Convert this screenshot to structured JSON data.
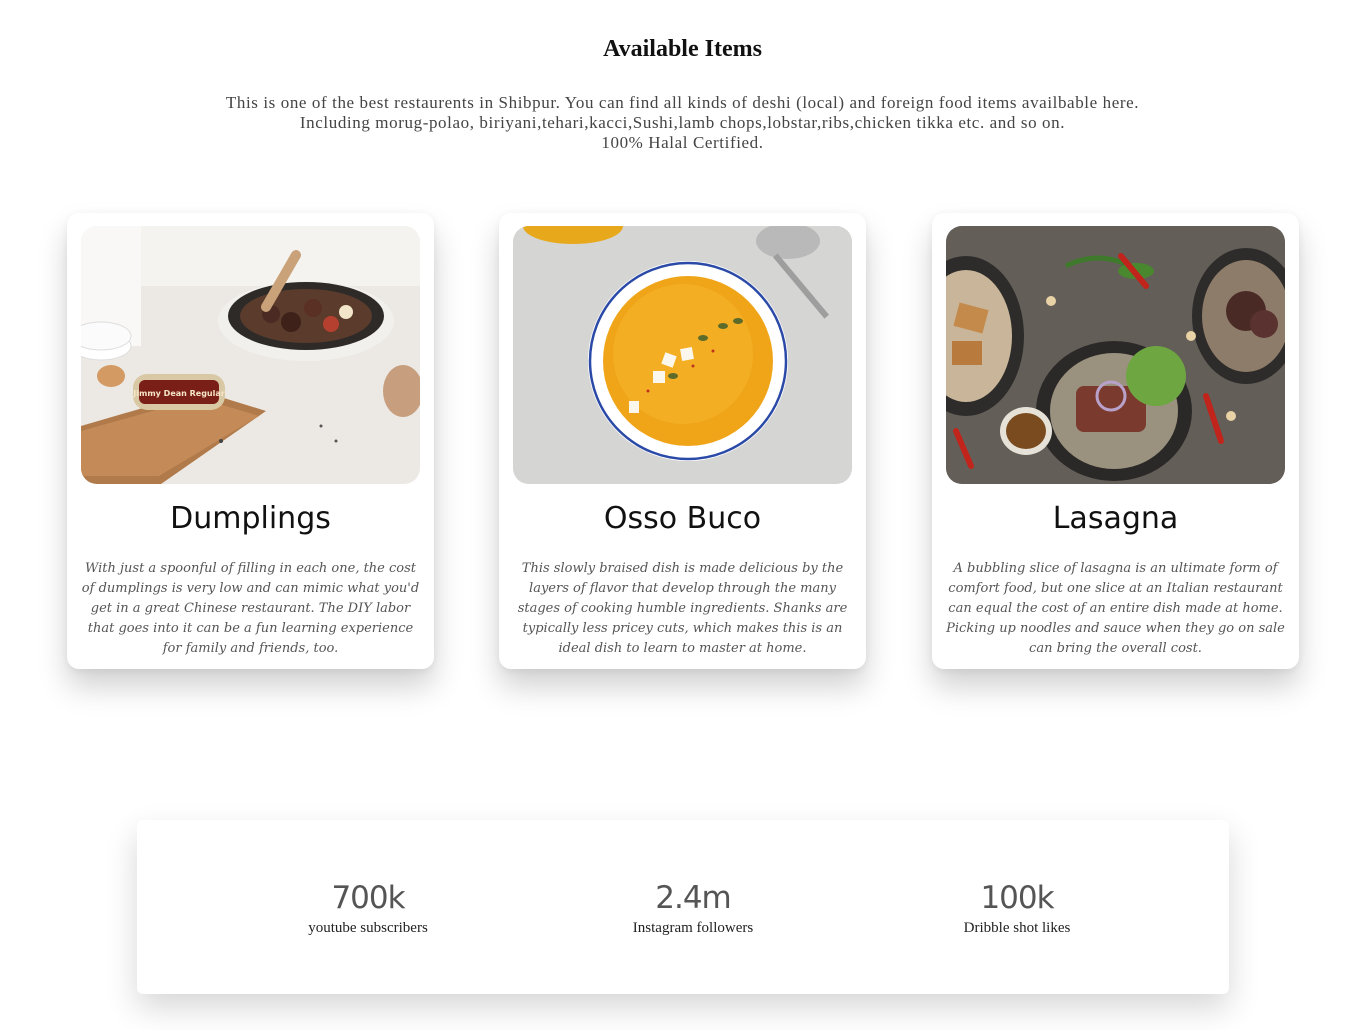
{
  "section": {
    "title": "Available Items",
    "intro_lines": [
      "This is one of the best restaurents in Shibpur. You can find all kinds of deshi (local) and foreign food items availbable here.",
      "Including morug-polao, biriyani,tehari,kacci,Sushi,lamb chops,lobstar,ribs,chicken tikka etc. and so on.",
      "100% Halal Certified."
    ]
  },
  "items": [
    {
      "title": "Dumplings",
      "image_label": "Jimmy Dean Regular",
      "description": "With just a spoonful of filling in each one, the cost of dumplings is very low and can mimic what you'd get in a great Chinese restaurant. The DIY labor that goes into it can be a fun learning experience for family and friends, too."
    },
    {
      "title": "Osso Buco",
      "description": "This slowly braised dish is made delicious by the layers of flavor that develop through the many stages of cooking humble ingredients. Shanks are typically less pricey cuts, which makes this is an ideal dish to learn to master at home."
    },
    {
      "title": "Lasagna",
      "description": "A bubbling slice of lasagna is an ultimate form of comfort food, but one slice at an Italian restaurant can equal the cost of an entire dish made at home. Picking up noodles and sauce when they go on sale can bring the overall cost."
    }
  ],
  "stats": [
    {
      "value": "700k",
      "label": "youtube subscribers"
    },
    {
      "value": "2.4m",
      "label": "Instagram followers"
    },
    {
      "value": "100k",
      "label": "Dribble shot likes"
    }
  ]
}
